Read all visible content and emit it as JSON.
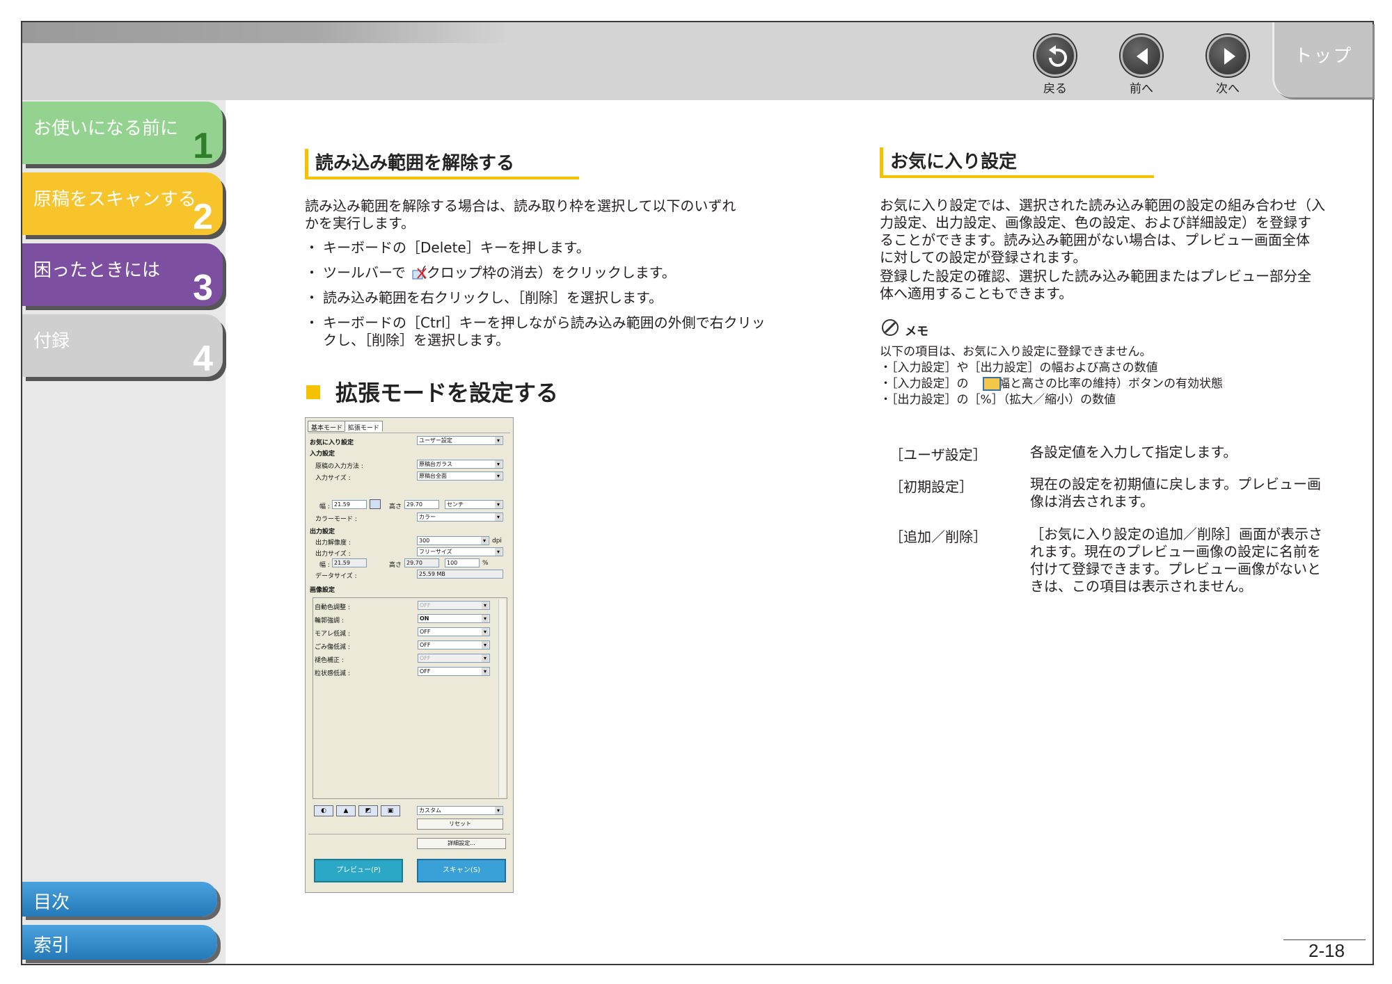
{
  "nav": {
    "back": "戻る",
    "prev": "前へ",
    "next": "次へ",
    "top": "トップ"
  },
  "sidebar": {
    "chapters": [
      {
        "label": "お使いになる前に",
        "num": "1"
      },
      {
        "label": "原稿をスキャンする",
        "num": "2"
      },
      {
        "label": "困ったときには",
        "num": "3"
      },
      {
        "label": "付録",
        "num": "4"
      }
    ],
    "toc": "目次",
    "index": "索引"
  },
  "left": {
    "heading": "読み込み範囲を解除する",
    "intro_1": "読み込み範囲を解除する場合は、読み取り枠を選択して以下のいずれ",
    "intro_2": "かを実行します。",
    "bullets": [
      "キーボードの［Delete］キーを押します。",
      "ツールバーで　（クロップ枠の消去）をクリックします。",
      "読み込み範囲を右クリックし、［削除］を選択します。",
      "キーボードの［Ctrl］キーを押しながら読み込み範囲の外側で右クリックし、［削除］を選択します。"
    ],
    "section_title": "拡張モードを設定する"
  },
  "scanner_ui": {
    "tab_basic": "基本モード",
    "tab_advanced": "拡張モード",
    "favorites_label": "お気に入り設定",
    "favorites_value": "ユーザー設定",
    "input_settings": "入力設定",
    "input_method_label": "原稿の入力方法 :",
    "input_method_value": "原稿台ガラス",
    "input_size_label": "入力サイズ :",
    "input_size_value": "原稿台全面",
    "width_label": "幅 :",
    "width_value": "21.59",
    "height_label": "高さ :",
    "height_value": "29.70",
    "unit_value": "センチ",
    "color_mode_label": "カラーモード :",
    "color_mode_value": "カラー",
    "output_settings": "出力設定",
    "resolution_label": "出力解像度 :",
    "resolution_value": "300",
    "resolution_unit": "dpi",
    "output_size_label": "出力サイズ :",
    "output_size_value": "フリーサイズ",
    "out_width_value": "21.59",
    "out_height_value": "29.70",
    "scale_value": "100",
    "scale_unit": "%",
    "data_size_label": "データサイズ :",
    "data_size_value": "25.59 MB",
    "image_settings": "画像設定",
    "image_rows": [
      {
        "label": "自動色調整 :",
        "value": "OFF",
        "disabled": true
      },
      {
        "label": "輪郭強調 :",
        "value": "ON",
        "disabled": false
      },
      {
        "label": "モアレ低減 :",
        "value": "OFF",
        "disabled": false
      },
      {
        "label": "ごみ傷低減 :",
        "value": "OFF",
        "disabled": false
      },
      {
        "label": "褪色補正 :",
        "value": "OFF",
        "disabled": true
      },
      {
        "label": "粒状感低減 :",
        "value": "OFF",
        "disabled": false
      }
    ],
    "custom_value": "カスタム",
    "reset_button": "リセット",
    "detail_button": "詳細設定...",
    "preview_button": "プレビュー(P)",
    "scan_button": "スキャン(S)"
  },
  "right": {
    "heading": "お気に入り設定",
    "paragraph_lines": [
      "お気に入り設定では、選択された読み込み範囲の設定の組み合わせ（入",
      "力設定、出力設定、画像設定、色の設定、および詳細設定）を登録す",
      "ることができます。読み込み範囲がない場合は、プレビュー画面全体",
      "に対しての設定が登録されます。",
      "登録した設定の確認、選択した読み込み範囲またはプレビュー部分全",
      "体へ適用することもできます。"
    ],
    "memo_title": "メモ",
    "memo_lines": [
      "以下の項目は、お気に入り設定に登録できません。",
      "・［入力設定］や［出力設定］の幅および高さの数値",
      "・［入力設定］の　　（幅と高さの比率の維持）ボタンの有効状態",
      "・［出力設定］の［%］（拡大／縮小）の数値"
    ],
    "definitions": [
      {
        "term": "［ユーザ設定］",
        "desc": [
          "各設定値を入力して指定します。"
        ]
      },
      {
        "term": "［初期設定］",
        "desc": [
          "現在の設定を初期値に戻します。プレビュー画",
          "像は消去されます。"
        ]
      },
      {
        "term": "［追加／削除］",
        "desc": [
          "［お気に入り設定の追加／削除］画面が表示さ",
          "れます。現在のプレビュー画像の設定に名前を",
          "付けて登録できます。プレビュー画像がないと",
          "きは、この項目は表示されません。"
        ]
      }
    ]
  },
  "page_number": "2-18"
}
